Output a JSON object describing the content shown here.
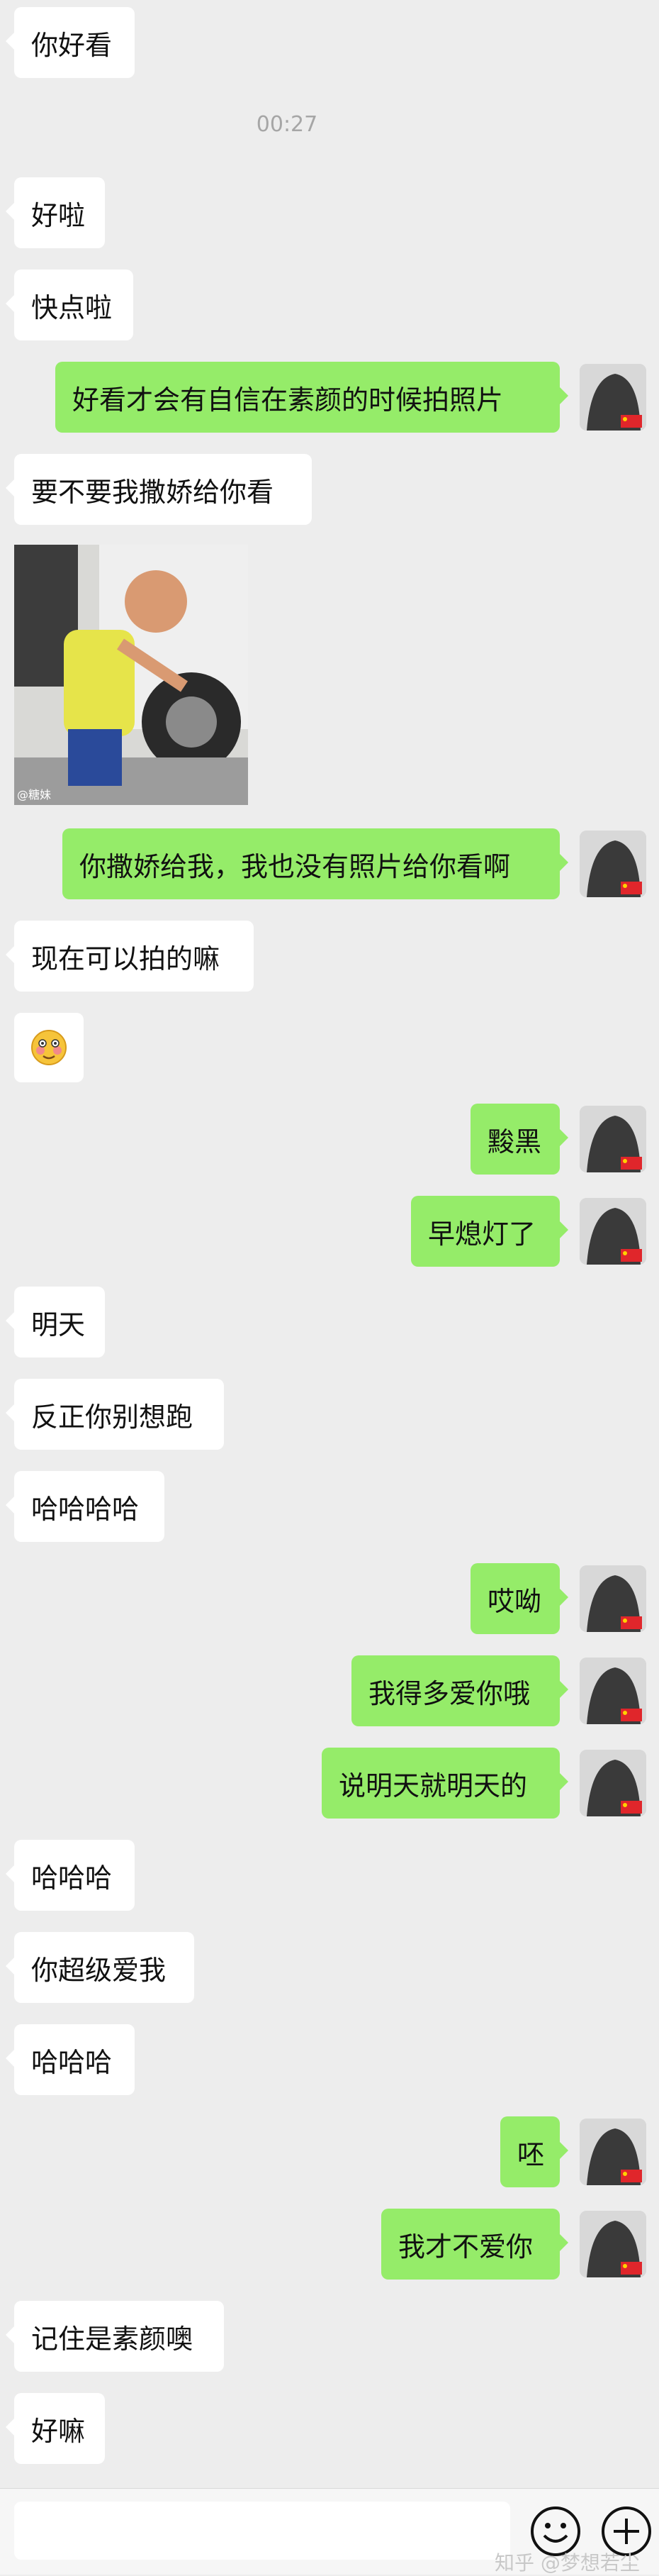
{
  "time_divider": "00:27",
  "messages": {
    "m1": "你好看",
    "m2": "好啦",
    "m3": "快点啦",
    "m4": "好看才会有自信在素颜的时候拍照片",
    "m5": "要不要我撒娇给你看",
    "m6_image": {
      "watermark": "@糖妹"
    },
    "m7": "你撒娇给我，我也没有照片给你看啊",
    "m8": "现在可以拍的嘛",
    "m9_emoji": "flushed-smile-emoji",
    "m10": "黢黑",
    "m11": "早熄灯了",
    "m12": "明天",
    "m13": "反正你别想跑",
    "m14": "哈哈哈哈",
    "m15": "哎呦",
    "m16": "我得多爱你哦",
    "m17": "说明天就明天的",
    "m18": "哈哈哈",
    "m19": "你超级爱我",
    "m20": "哈哈哈",
    "m21": "呸",
    "m22": "我才不爱你",
    "m23": "记住是素颜噢",
    "m24": "好嘛"
  },
  "input_bar": {
    "emoji_button_icon": "smiley-face-icon",
    "add_button_icon": "plus-circle-icon"
  },
  "watermark": "知乎 @梦想若尘",
  "colors": {
    "background": "#ededed",
    "sent_bubble": "#95ec69",
    "received_bubble": "#ffffff"
  }
}
